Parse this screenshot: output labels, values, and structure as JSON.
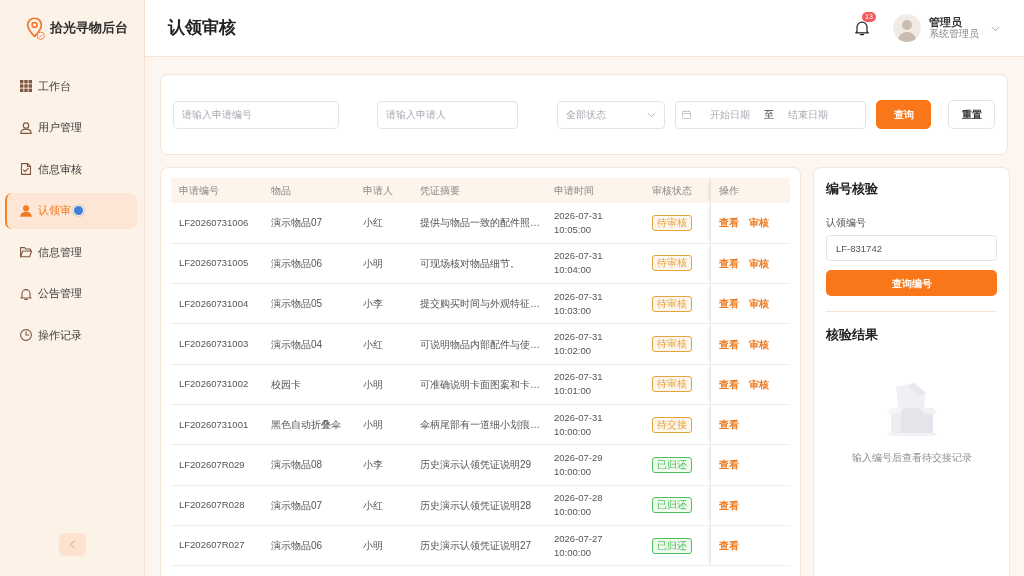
{
  "sidebar": {
    "title": "拾光寻物后台",
    "items": [
      {
        "kind": "grid",
        "label": "工作台",
        "selected": false
      },
      {
        "kind": "user",
        "label": "用户管理",
        "selected": false
      },
      {
        "kind": "document-check",
        "label": "信息审核",
        "selected": false
      },
      {
        "kind": "person",
        "label": "认领审",
        "selected": true
      },
      {
        "kind": "folder",
        "label": "信息管理",
        "selected": false
      },
      {
        "kind": "bell",
        "label": "公告管理",
        "selected": false
      },
      {
        "kind": "clock",
        "label": "操作记录",
        "selected": false
      }
    ]
  },
  "header": {
    "title": "认领审核",
    "notification_count": "13",
    "user": {
      "name": "管理员",
      "role": "系统管理员"
    }
  },
  "filters": {
    "application_no": {
      "placeholder": "请输入申请编号"
    },
    "applicant": {
      "placeholder": "请输入申请人"
    },
    "status": {
      "placeholder": "全部状态"
    },
    "date_range": {
      "start_placeholder": "开始日期",
      "separator": "至",
      "end_placeholder": "结束日期"
    },
    "buttons": [
      {
        "label": "查询",
        "kind": "primary"
      },
      {
        "label": "重置",
        "kind": "default"
      }
    ]
  },
  "table": {
    "columns": [
      "申请编号",
      "物品",
      "申请人",
      "凭证摘要",
      "申请时间",
      "审核状态",
      "操作"
    ],
    "rows": [
      {
        "id": "LF20260731006",
        "item": "演示物品07",
        "applicant": "小红",
        "summary": "提供与物品一致的配件照…",
        "time": "2026-07-31 10:05:00",
        "status": {
          "label": "待审核",
          "color": "#e6a23c"
        },
        "actions": [
          "查看",
          "审核"
        ]
      },
      {
        "id": "LF20260731005",
        "item": "演示物品06",
        "applicant": "小明",
        "summary": "可现场核对物品细节。",
        "time": "2026-07-31 10:04:00",
        "status": {
          "label": "待审核",
          "color": "#e6a23c"
        },
        "actions": [
          "查看",
          "审核"
        ]
      },
      {
        "id": "LF20260731004",
        "item": "演示物品05",
        "applicant": "小李",
        "summary": "提交购买时间与外观特征…",
        "time": "2026-07-31 10:03:00",
        "status": {
          "label": "待审核",
          "color": "#e6a23c"
        },
        "actions": [
          "查看",
          "审核"
        ]
      },
      {
        "id": "LF20260731003",
        "item": "演示物品04",
        "applicant": "小红",
        "summary": "可说明物品内部配件与使…",
        "time": "2026-07-31 10:02:00",
        "status": {
          "label": "待审核",
          "color": "#e6a23c"
        },
        "actions": [
          "查看",
          "审核"
        ]
      },
      {
        "id": "LF20260731002",
        "item": "校园卡",
        "applicant": "小明",
        "summary": "可准确说明卡面图案和卡…",
        "time": "2026-07-31 10:01:00",
        "status": {
          "label": "待审核",
          "color": "#e6a23c"
        },
        "actions": [
          "查看",
          "审核"
        ]
      },
      {
        "id": "LF20260731001",
        "item": "黑色自动折叠伞",
        "applicant": "小明",
        "summary": "伞柄尾部有一道细小划痕…",
        "time": "2026-07-31 10:00:00",
        "status": {
          "label": "待交接",
          "color": "#e6a23c"
        },
        "actions": [
          "查看"
        ]
      },
      {
        "id": "LF202607R029",
        "item": "演示物品08",
        "applicant": "小李",
        "summary": "历史演示认领凭证说明29",
        "time": "2026-07-29 10:00:00",
        "status": {
          "label": "已归还",
          "color": "#4fbf5a"
        },
        "actions": [
          "查看"
        ]
      },
      {
        "id": "LF202607R028",
        "item": "演示物品07",
        "applicant": "小红",
        "summary": "历史演示认领凭证说明28",
        "time": "2026-07-28 10:00:00",
        "status": {
          "label": "已归还",
          "color": "#4fbf5a"
        },
        "actions": [
          "查看"
        ]
      },
      {
        "id": "LF202607R027",
        "item": "演示物品06",
        "applicant": "小明",
        "summary": "历史演示认领凭证说明27",
        "time": "2026-07-27 10:00:00",
        "status": {
          "label": "已归还",
          "color": "#4fbf5a"
        },
        "actions": [
          "查看"
        ]
      }
    ]
  },
  "verify_panel": {
    "title": "编号核验",
    "field_label": "认领编号",
    "value": "LF-831742",
    "button": "查询编号",
    "result_title": "核验结果",
    "empty_text": "输入编号后查看待交接记录"
  }
}
